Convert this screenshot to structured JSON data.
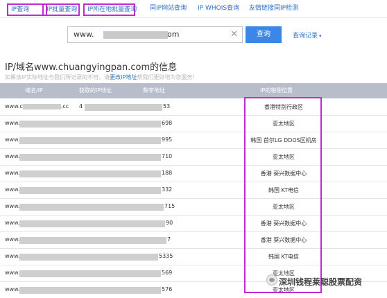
{
  "nav": {
    "tabs": [
      "IP查询",
      "IP批量查询",
      "IP所在地批量查询",
      "同IP网站查询",
      "IP WHOIS查询",
      "友情链接同IP检测"
    ]
  },
  "search": {
    "value_prefix": "www.",
    "value_suffix": ".com",
    "button": "查询",
    "history": "查询记录"
  },
  "page": {
    "title": "IP/域名www.chuangyingpan.com的信息",
    "note": "如果该IP实际地址与我们所记录的不符，请",
    "note_link": "更改IP地址",
    "note_tail": "帮我们更好地为您服务！"
  },
  "table": {
    "headers": [
      "域名/IP",
      "获取的IP地址",
      "数字地址",
      "IP的物理位置"
    ],
    "rows": [
      {
        "domain_prefix": "www.c",
        "domain_suffix": ".cc",
        "ip_start": "4",
        "ip_end": "53",
        "location": "香港特别行政区"
      },
      {
        "domain_prefix": "www.",
        "domain_suffix": "",
        "ip_start": "",
        "ip_end": "698",
        "location": "亚太地区"
      },
      {
        "domain_prefix": "www.",
        "domain_suffix": "",
        "ip_start": "",
        "ip_end": "995",
        "location": "韩国 首尔LG DDOS区机房"
      },
      {
        "domain_prefix": "www.",
        "domain_suffix": "",
        "ip_start": "",
        "ip_end": "710",
        "location": "亚太地区"
      },
      {
        "domain_prefix": "www.",
        "domain_suffix": "",
        "ip_start": "",
        "ip_end": "188",
        "location": "香港 葵兴数据中心"
      },
      {
        "domain_prefix": "www.",
        "domain_suffix": "",
        "ip_start": "",
        "ip_end": "332",
        "location": "韩国 KT电信"
      },
      {
        "domain_prefix": "www.",
        "domain_suffix": "",
        "ip_start": "",
        "ip_end": "715",
        "location": "亚太地区"
      },
      {
        "domain_prefix": "www.",
        "domain_suffix": "",
        "ip_start": "",
        "ip_end": "90",
        "location": "香港 葵兴数据中心"
      },
      {
        "domain_prefix": "www.",
        "domain_suffix": "",
        "ip_start": "",
        "ip_end": "7",
        "location": "香港 葵兴数据中心"
      },
      {
        "domain_prefix": "www.",
        "domain_suffix": "",
        "ip_start": "",
        "ip_end": "5335",
        "location": "韩国 KT电信"
      },
      {
        "domain_prefix": "www.",
        "domain_suffix": "",
        "ip_start": "",
        "ip_end": "569",
        "location": "亚太地区"
      },
      {
        "domain_prefix": "www.",
        "domain_suffix": "",
        "ip_start": "",
        "ip_end": "576",
        "location": "亚太地区"
      }
    ]
  },
  "watermark": "深圳钱程莱聪股票配资",
  "colors": {
    "accent": "#3c86e8",
    "highlight": "#c02bd1",
    "header_bg": "#b7bdcb",
    "link": "#2b6fc2"
  }
}
